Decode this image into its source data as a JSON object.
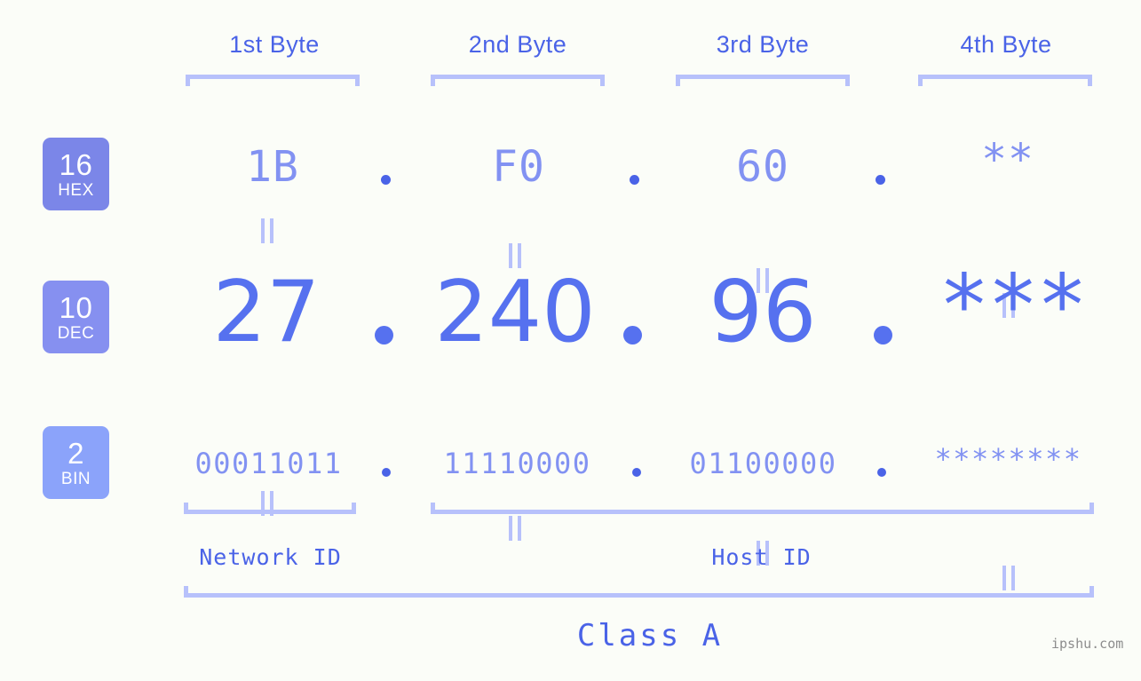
{
  "background_color": "#fbfdf8",
  "accent_colors": {
    "strong_blue": "#4a63e7",
    "dec_blue": "#5671ef",
    "light_blue": "#8292f2",
    "bracket": "#b7c1fb",
    "badge_hex": "#7b86e8",
    "badge_dec": "#8690f0",
    "badge_bin": "#8ba3fa",
    "watermark_gray": "#8d8d8d"
  },
  "byte_headers": [
    {
      "label": "1st Byte"
    },
    {
      "label": "2nd Byte"
    },
    {
      "label": "3rd Byte"
    },
    {
      "label": "4th Byte"
    }
  ],
  "rows": [
    {
      "badge_number": "16",
      "badge_name": "HEX",
      "values": [
        "1B",
        "F0",
        "60",
        "**"
      ],
      "separator": "."
    },
    {
      "badge_number": "10",
      "badge_name": "DEC",
      "values": [
        "27",
        "240",
        "96",
        "***"
      ],
      "separator": "."
    },
    {
      "badge_number": "2",
      "badge_name": "BIN",
      "values": [
        "00011011",
        "11110000",
        "01100000",
        "********"
      ],
      "separator": "."
    }
  ],
  "id_sections": [
    {
      "label": "Network ID"
    },
    {
      "label": "Host ID"
    }
  ],
  "class_label": "Class A",
  "watermark": "ipshu.com",
  "chart_data": {
    "type": "table",
    "title": "IPv4 address byte breakdown",
    "categories": [
      "1st Byte",
      "2nd Byte",
      "3rd Byte",
      "4th Byte"
    ],
    "series": [
      {
        "name": "HEX",
        "values": [
          "1B",
          "F0",
          "60",
          "**"
        ]
      },
      {
        "name": "DEC",
        "values": [
          "27",
          "240",
          "96",
          "***"
        ]
      },
      {
        "name": "BIN",
        "values": [
          "00011011",
          "11110000",
          "01100000",
          "********"
        ]
      }
    ],
    "annotations": [
      "Network ID",
      "Host ID",
      "Class A"
    ]
  }
}
